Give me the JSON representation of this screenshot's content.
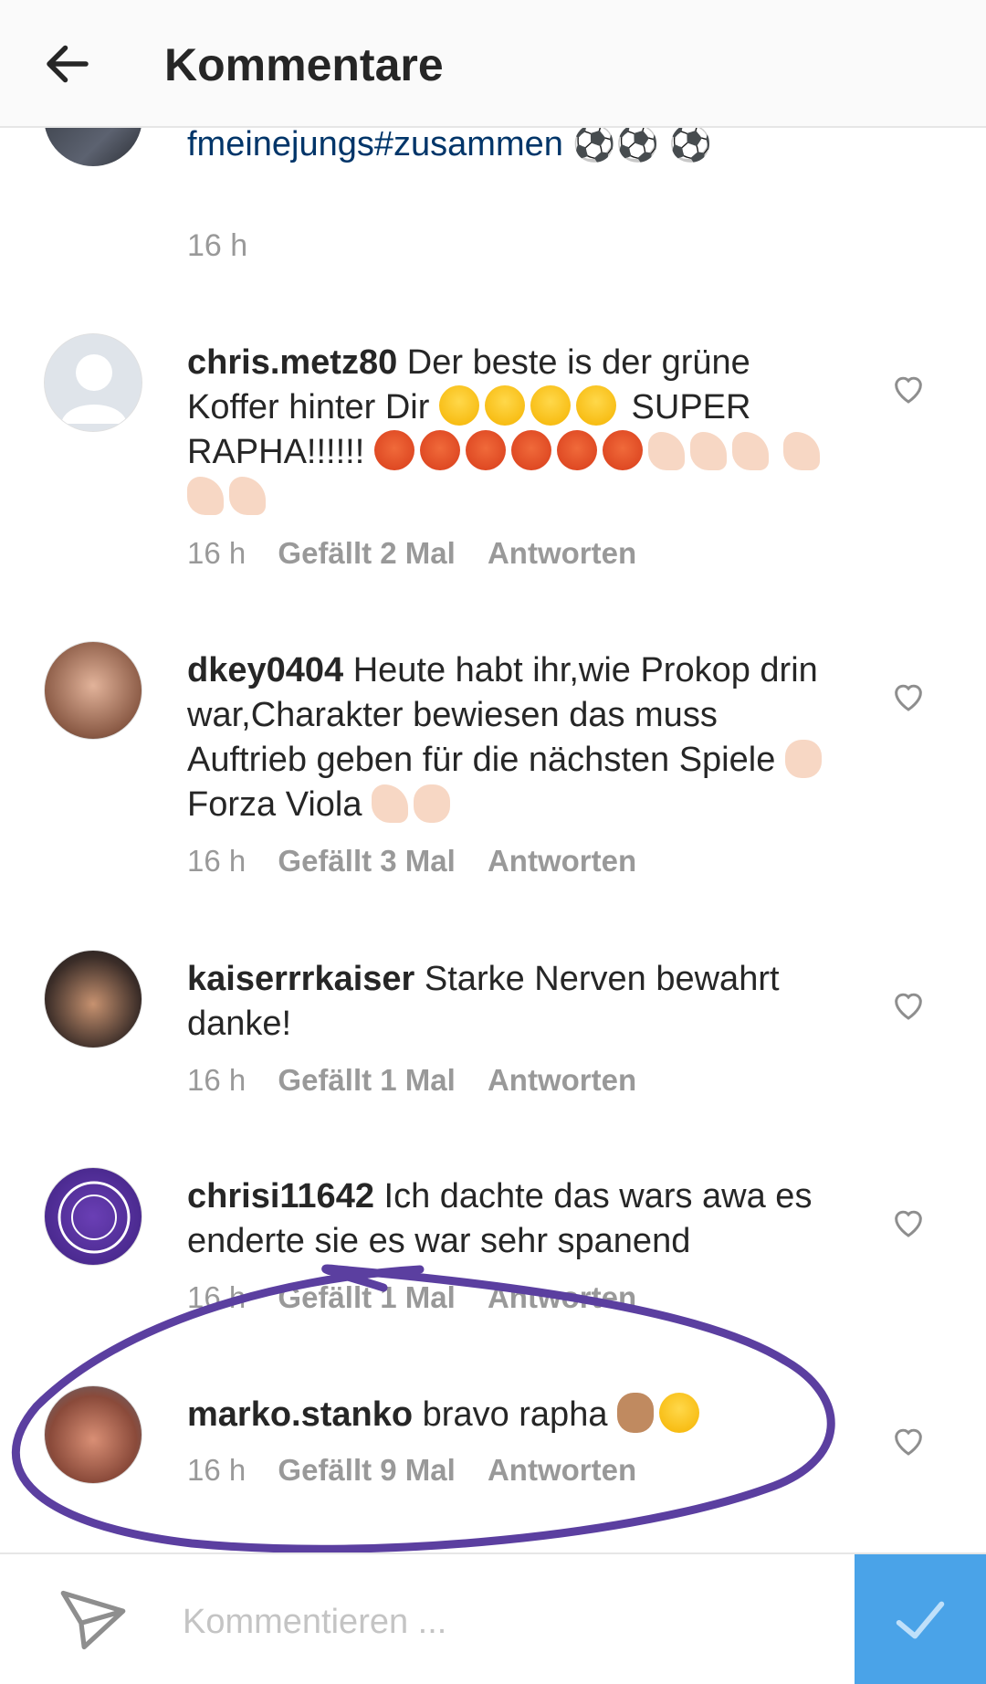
{
  "header": {
    "title": "Kommentare"
  },
  "caption": {
    "text": "fmeinejungs#zusammen ⚽⚽ ⚽",
    "time": "16 h"
  },
  "comments": [
    {
      "username": "chris.metz80",
      "text": "Der beste is der grüne Koffer hinter Dir",
      "text2": "SUPER RAPHA!!!!!!",
      "time": "16 h",
      "likes": "Gefällt 2 Mal",
      "reply": "Antworten"
    },
    {
      "username": "dkey0404",
      "text": "Heute habt ihr,wie Prokop drin war,Charakter bewiesen das muss Auftrieb geben für die nächsten Spiele",
      "text2": "Forza Viola",
      "time": "16 h",
      "likes": "Gefällt 3 Mal",
      "reply": "Antworten"
    },
    {
      "username": "kaiserrrkaiser",
      "text": "Starke Nerven bewahrt danke!",
      "time": "16 h",
      "likes": "Gefällt 1 Mal",
      "reply": "Antworten"
    },
    {
      "username": "chrisi11642",
      "text": "Ich dachte das wars awa es enderte sie es war sehr spanend",
      "time": "16 h",
      "likes": "Gefällt 1 Mal",
      "reply": "Antworten"
    },
    {
      "username": "marko.stanko",
      "text": "bravo rapha",
      "time": "16 h",
      "likes": "Gefällt 9 Mal",
      "reply": "Antworten"
    }
  ],
  "input": {
    "placeholder": "Kommentieren ..."
  },
  "colors": {
    "accent": "#4aa3e8",
    "link": "#003569",
    "annotation": "#5b3fa0"
  },
  "icons": {
    "back": "arrow-left-icon",
    "like": "heart-outline-icon",
    "send": "paper-plane-icon",
    "post": "checkmark-icon"
  }
}
